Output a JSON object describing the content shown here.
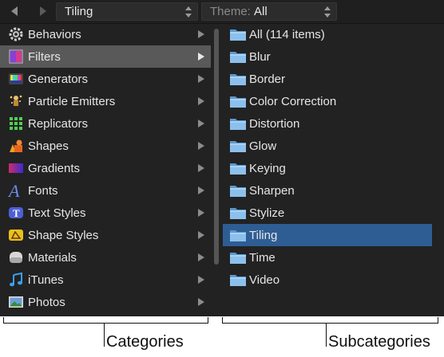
{
  "toolbar": {
    "back_arrow": "left-arrow",
    "forward_arrow": "right-arrow",
    "location_value": "Tiling",
    "theme_label": "Theme:",
    "theme_value": "All"
  },
  "categories": [
    {
      "label": "Behaviors",
      "icon": "gear-icon"
    },
    {
      "label": "Filters",
      "icon": "filters-icon",
      "selected": true
    },
    {
      "label": "Generators",
      "icon": "generators-icon"
    },
    {
      "label": "Particle Emitters",
      "icon": "particle-emitters-icon"
    },
    {
      "label": "Replicators",
      "icon": "replicators-icon"
    },
    {
      "label": "Shapes",
      "icon": "shapes-icon"
    },
    {
      "label": "Gradients",
      "icon": "gradients-icon"
    },
    {
      "label": "Fonts",
      "icon": "fonts-icon"
    },
    {
      "label": "Text Styles",
      "icon": "text-styles-icon"
    },
    {
      "label": "Shape Styles",
      "icon": "shape-styles-icon"
    },
    {
      "label": "Materials",
      "icon": "materials-icon"
    },
    {
      "label": "iTunes",
      "icon": "music-note-icon"
    },
    {
      "label": "Photos",
      "icon": "photos-icon"
    }
  ],
  "subcategories": [
    {
      "label": "All (114 items)"
    },
    {
      "label": "Blur"
    },
    {
      "label": "Border"
    },
    {
      "label": "Color Correction"
    },
    {
      "label": "Distortion"
    },
    {
      "label": "Glow"
    },
    {
      "label": "Keying"
    },
    {
      "label": "Sharpen"
    },
    {
      "label": "Stylize"
    },
    {
      "label": "Tiling",
      "selected": true
    },
    {
      "label": "Time"
    },
    {
      "label": "Video"
    }
  ],
  "annotations": {
    "categories_label": "Categories",
    "subcategories_label": "Subcategories"
  },
  "colors": {
    "panel_bg": "#222222",
    "selection_gray": "#595959",
    "selection_blue": "#2e5d94",
    "folder_blue": "#7fb6e6"
  }
}
